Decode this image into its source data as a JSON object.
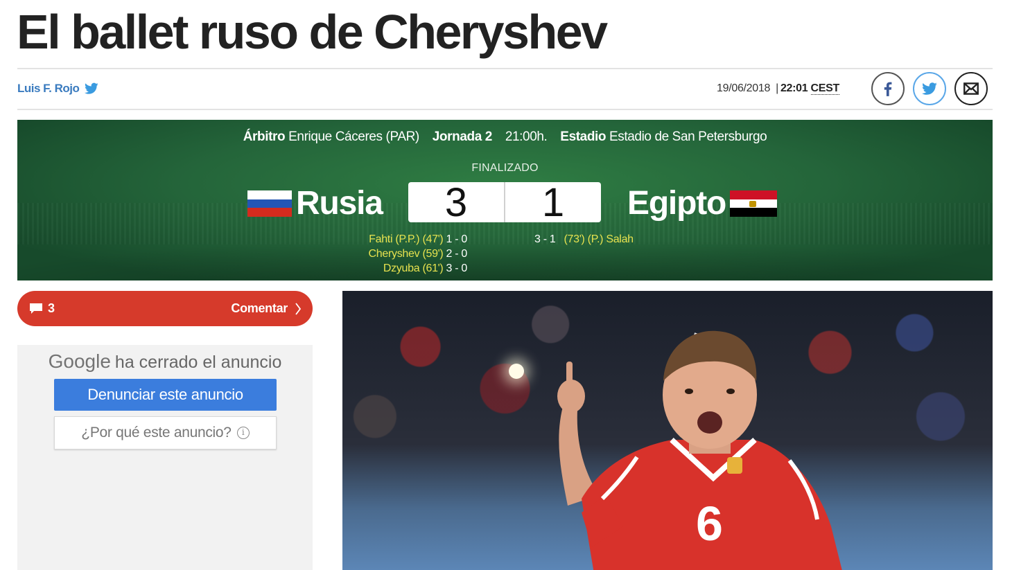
{
  "article": {
    "headline": "El ballet ruso de Cheryshev",
    "author": "Luis F. Rojo",
    "date": "19/06/2018",
    "separator": "|",
    "time": "22:01",
    "timezone": "CEST"
  },
  "share": {
    "facebook": "facebook-icon",
    "twitter": "twitter-icon",
    "email": "mail-icon"
  },
  "match": {
    "referee_label": "Árbitro",
    "referee": "Enrique Cáceres (PAR)",
    "matchday_label": "Jornada 2",
    "kickoff": "21:00h.",
    "stadium_label": "Estadio",
    "stadium": "Estadio de San Petersburgo",
    "status": "FINALIZADO",
    "home_team": "Rusia",
    "away_team": "Egipto",
    "home_score": "3",
    "away_score": "1",
    "home_goals": [
      {
        "text": "Fahti (P.P.) (47')",
        "score": "1 - 0"
      },
      {
        "text": "Cheryshev (59')",
        "score": "2 - 0"
      },
      {
        "text": "Dzyuba (61')",
        "score": "3 - 0"
      }
    ],
    "away_goals": [
      {
        "score": "3 - 1",
        "text": "(73') (P.) Salah"
      }
    ],
    "colors": {
      "goal_text": "#e7e24f",
      "pitch": "#24653a"
    }
  },
  "comments": {
    "count": "3",
    "cta": "Comentar",
    "bar_color": "#d63a2b"
  },
  "ad": {
    "brand": "Google",
    "closed_text": "ha cerrado el anuncio",
    "report_button": "Denunciar este anuncio",
    "why_button": "¿Por qué este anuncio?",
    "info_glyph": "i"
  }
}
